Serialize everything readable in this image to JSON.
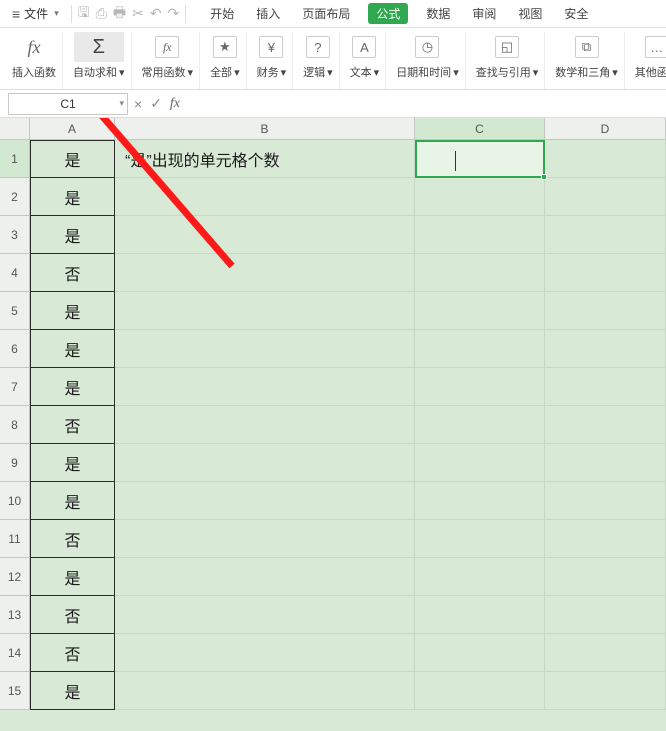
{
  "menu": {
    "file_label": "文件",
    "tabs": [
      "开始",
      "插入",
      "页面布局",
      "公式",
      "数据",
      "审阅",
      "视图",
      "安全"
    ],
    "active_tab_index": 3
  },
  "ribbon": {
    "insert_fn": {
      "label": "插入函数",
      "icon_text": "fx"
    },
    "auto_sum": {
      "label": "自动求和",
      "icon_text": "Σ"
    },
    "common_fn": {
      "label": "常用函数",
      "icon_text": "fx★"
    },
    "all": {
      "label": "全部",
      "icon_text": "★"
    },
    "finance": {
      "label": "财务",
      "icon_text": "¥"
    },
    "logic": {
      "label": "逻辑",
      "icon_text": "?"
    },
    "text": {
      "label": "文本",
      "icon_text": "A"
    },
    "datetime": {
      "label": "日期和时间",
      "icon_text": "◷"
    },
    "lookup": {
      "label": "查找与引用",
      "icon_text": "Q"
    },
    "math": {
      "label": "数学和三角",
      "icon_text": "⧉"
    },
    "other": {
      "label": "其他函数"
    }
  },
  "namebox": {
    "value": "C1"
  },
  "formula_bar": {
    "cancel": "×",
    "accept": "✓",
    "fx": "fx",
    "formula": ""
  },
  "columns": [
    "A",
    "B",
    "C",
    "D"
  ],
  "row_count": 15,
  "selected_column_index": 2,
  "selected_row_index": 0,
  "cells": {
    "B1": "“是”出现的单元格个数",
    "A": [
      "是",
      "是",
      "是",
      "否",
      "是",
      "是",
      "是",
      "否",
      "是",
      "是",
      "否",
      "是",
      "否",
      "否",
      "是"
    ]
  },
  "arrow": {
    "note": "red annotation arrow",
    "color": "#ff1a1a"
  }
}
